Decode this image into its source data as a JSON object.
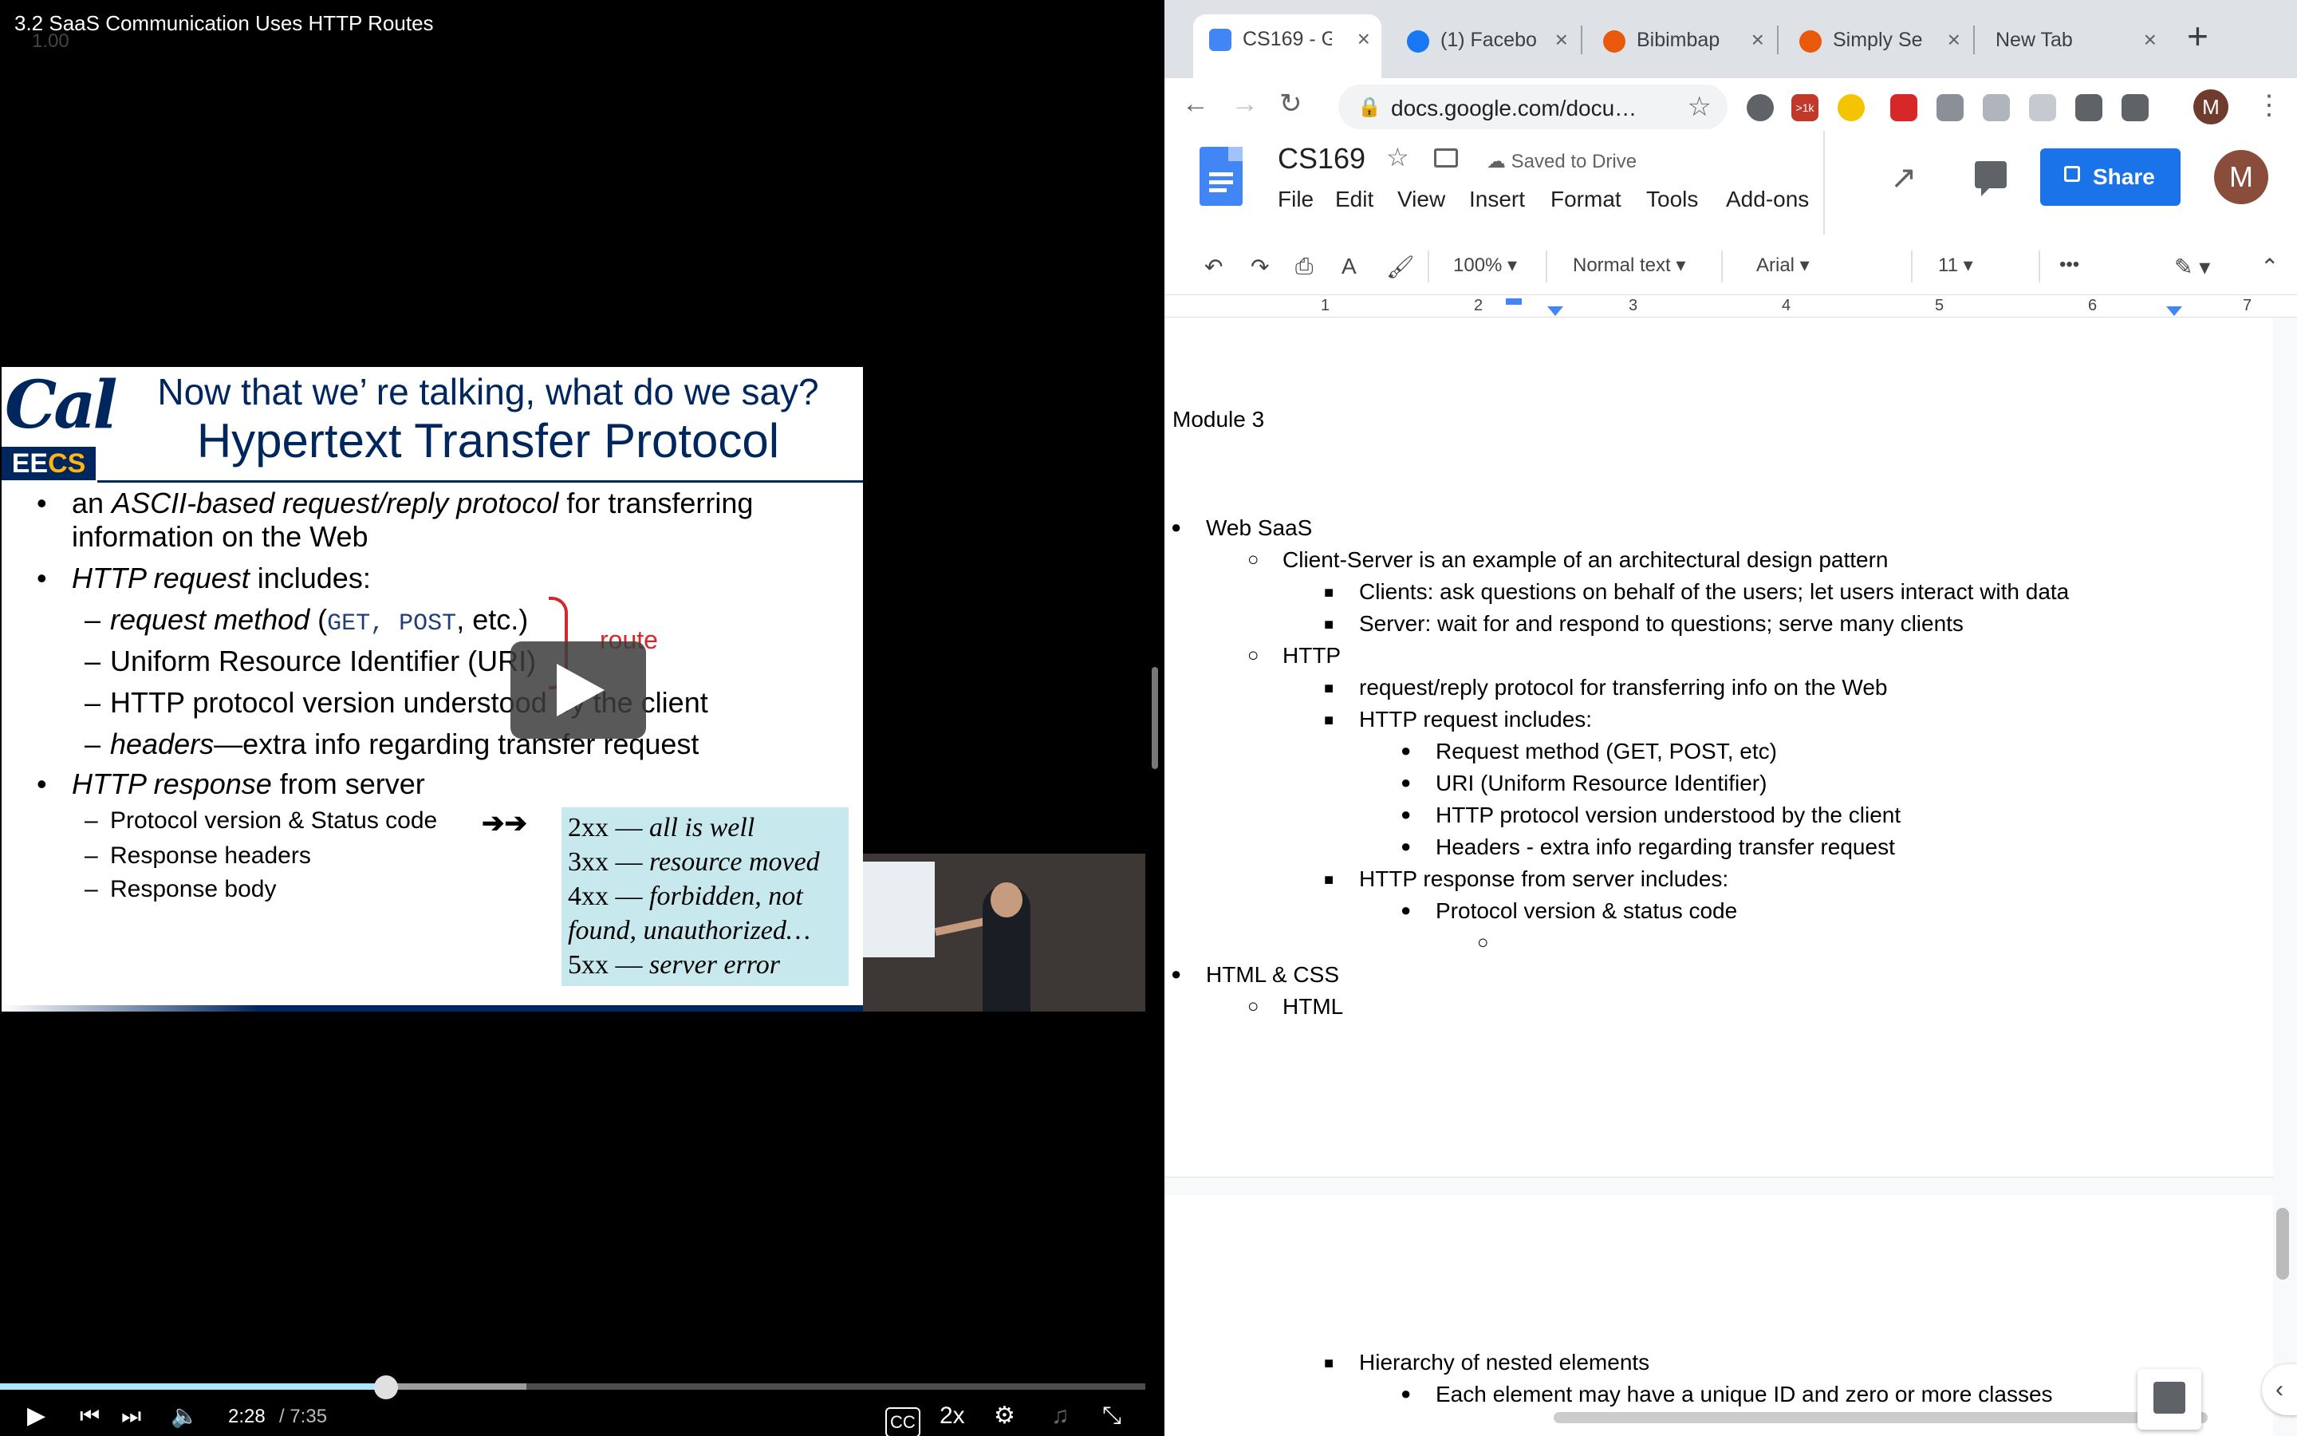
{
  "video": {
    "title": "3.2 SaaS Communication Uses HTTP Routes",
    "speed_overlay": "1.00",
    "current_time": "2:28",
    "duration": "/ 7:35",
    "progress_fraction": 0.337,
    "playback_rate": "2x",
    "captions_label": "CC",
    "slide": {
      "logo_word": "Cal",
      "logo_badge_a": "EE",
      "logo_badge_b": "CS",
      "title_line1": "Now that we’ re talking, what do we say?",
      "title_line2": "Hypertext Transfer Protocol",
      "b1_a": "an ",
      "b1_italic": "ASCII-based request/reply protocol",
      "b1_b": " for transferring",
      "b1_line2": "information on the Web",
      "b2_italic": "HTTP request",
      "b2_rest": " includes:",
      "b2_sub1_italic": "request method",
      "b2_sub1_a": " (",
      "b2_sub1_code": "GET, POST",
      "b2_sub1_b": ", etc.)",
      "b2_sub2": "Uniform Resource Identifier (URI)",
      "b2_sub3": "HTTP protocol version understood by the client",
      "b2_sub4_italic": "headers",
      "b2_sub4_rest": "—extra info regarding transfer request",
      "route_label": "route",
      "b3_italic": "HTTP response",
      "b3_rest": " from server",
      "b3_sub1": "Protocol version & Status code",
      "b3_sub2": "Response headers",
      "b3_sub3": "Response body",
      "arrows": "➔➔",
      "dash": "–",
      "bullet": "•",
      "codes": [
        {
          "code": "2xx — ",
          "desc": "all is well"
        },
        {
          "code": "3xx — ",
          "desc": "resource moved"
        },
        {
          "code": "4xx — ",
          "desc": "forbidden, not"
        },
        {
          "code": "",
          "desc": "found, unauthorized…"
        },
        {
          "code": "5xx — ",
          "desc": "server error"
        }
      ]
    }
  },
  "browser": {
    "tabs": [
      {
        "label": "CS169 - G",
        "icon": "google-docs-icon",
        "color": "#4285f4",
        "active": true
      },
      {
        "label": "(1) Facebo",
        "icon": "facebook-icon",
        "color": "#1877f2",
        "active": false
      },
      {
        "label": "Bibimbap",
        "icon": "recipe-site-icon",
        "color": "#e8590c",
        "active": false
      },
      {
        "label": "Simply Se",
        "icon": "recipe-site-icon",
        "color": "#e8590c",
        "active": false
      },
      {
        "label": "New Tab",
        "icon": "",
        "color": "",
        "active": false
      }
    ],
    "tab_close": "×",
    "new_tab": "+",
    "url": "docs.google.com/docu…",
    "extension_badge": ">1k",
    "profile_initial": "M"
  },
  "docs": {
    "title": "CS169",
    "save_status": "Saved to Drive",
    "menu": [
      "File",
      "Edit",
      "View",
      "Insert",
      "Format",
      "Tools",
      "Add-ons"
    ],
    "share_label": "Share",
    "account_initial": "M",
    "toolbar": {
      "zoom": "100%",
      "style": "Normal text",
      "font": "Arial",
      "size": "11",
      "more": "•••"
    },
    "ruler_numbers": [
      "1",
      "2",
      "3",
      "4",
      "5",
      "6",
      "7"
    ],
    "heading": "Module 3",
    "outline": [
      {
        "level": 1,
        "marker": "●",
        "text": "Web SaaS"
      },
      {
        "level": 2,
        "marker": "○",
        "text": "Client-Server is an example of an architectural design pattern"
      },
      {
        "level": 3,
        "marker": "■",
        "text": "Clients: ask questions on behalf of the users; let users interact with data"
      },
      {
        "level": 3,
        "marker": "■",
        "text": "Server: wait for and respond to questions; serve many clients"
      },
      {
        "level": 2,
        "marker": "○",
        "text": "HTTP"
      },
      {
        "level": 3,
        "marker": "■",
        "text": "request/reply protocol for transferring info on the Web"
      },
      {
        "level": 3,
        "marker": "■",
        "text": "HTTP request includes:"
      },
      {
        "level": 4,
        "marker": "●",
        "text": "Request method (GET, POST, etc)"
      },
      {
        "level": 4,
        "marker": "●",
        "text": "URI (Uniform Resource Identifier)"
      },
      {
        "level": 4,
        "marker": "●",
        "text": "HTTP protocol version understood by the client"
      },
      {
        "level": 4,
        "marker": "●",
        "text": "Headers - extra info regarding transfer request"
      },
      {
        "level": 3,
        "marker": "■",
        "text": "HTTP response from server includes:"
      },
      {
        "level": 4,
        "marker": "●",
        "text": "Protocol version & status code"
      },
      {
        "level": 5,
        "marker": "○",
        "text": ""
      },
      {
        "level": 1,
        "marker": "●",
        "text": "HTML & CSS"
      },
      {
        "level": 2,
        "marker": "○",
        "text": "HTML"
      }
    ],
    "page2_outline": [
      {
        "level": 3,
        "marker": "■",
        "text": "Hierarchy of nested elements"
      },
      {
        "level": 4,
        "marker": "●",
        "text": "Each element may have a unique ID and zero or more classes"
      }
    ]
  }
}
